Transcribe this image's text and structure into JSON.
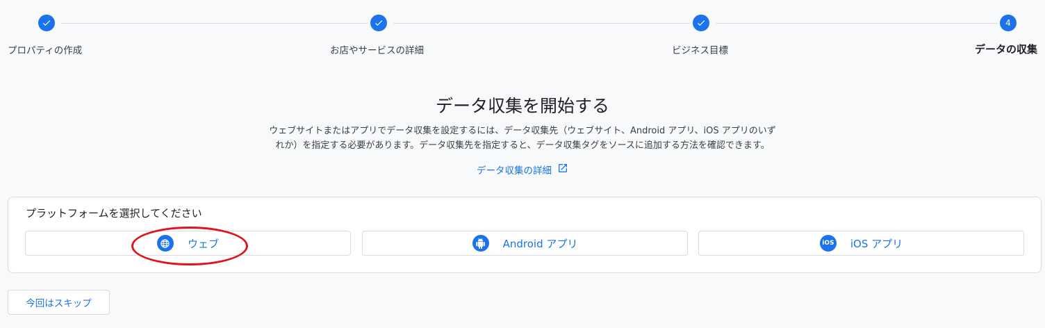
{
  "stepper": {
    "steps": [
      {
        "label": "プロパティの作成",
        "status": "completed"
      },
      {
        "label": "お店やサービスの詳細",
        "status": "completed"
      },
      {
        "label": "ビジネス目標",
        "status": "completed"
      },
      {
        "label": "データの収集",
        "status": "current",
        "number": "4"
      }
    ]
  },
  "main": {
    "title": "データ収集を開始する",
    "description_line1": "ウェブサイトまたはアプリでデータ収集を設定するには、データ収集先（ウェブサイト、Android アプリ、iOS アプリのいず",
    "description_line2": "れか）を指定する必要があります。データ収集先を指定すると、データ収集タグをソースに追加する方法を確認できます。",
    "learn_more_label": "データ収集の詳細"
  },
  "platform": {
    "title": "プラットフォームを選択してください",
    "options": [
      {
        "label": "ウェブ",
        "icon": "globe-icon"
      },
      {
        "label": "Android アプリ",
        "icon": "android-icon"
      },
      {
        "label": "iOS アプリ",
        "icon": "ios-icon",
        "icon_text": "iOS"
      }
    ]
  },
  "footer": {
    "skip_label": "今回はスキップ"
  },
  "colors": {
    "accent": "#1a73e8",
    "annotation": "#e0141e"
  }
}
